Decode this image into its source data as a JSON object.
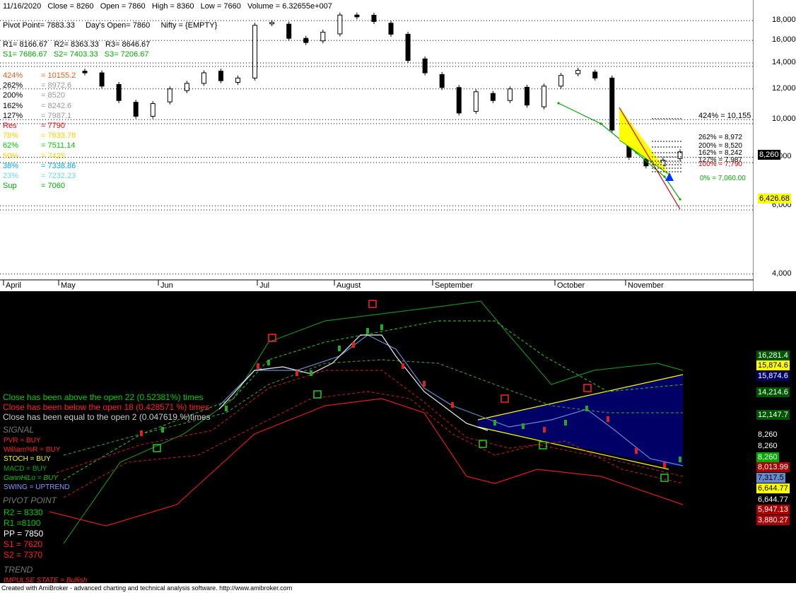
{
  "header": {
    "date": "11/16/2020",
    "close": "Close = 8260",
    "open": "Open = 7860",
    "high": "High = 8360",
    "low": "Low = 7660",
    "volume": "Volume = 6.32655e+007",
    "pivot": "Pivot Point= 7883.33",
    "days_open": "Day's Open= 7860",
    "nifty": "Nifty = {EMPTY}",
    "r1": "R1= 8166.67",
    "r2": "R2= 8363.33",
    "r3": "R3= 8646.67",
    "s1": "S1= 7686.67",
    "s2": "S2= 7403.33",
    "s3": "S3= 7206.67"
  },
  "fib_levels": [
    {
      "label": "424%",
      "value": "10155.2",
      "color": "#e06020"
    },
    {
      "label": "262%",
      "value": "8972.6",
      "color": "#999999"
    },
    {
      "label": "200%",
      "value": "8520",
      "color": "#999999"
    },
    {
      "label": "162%",
      "value": "8242.6",
      "color": "#999999"
    },
    {
      "label": "127%",
      "value": "7987.1",
      "color": "#999999"
    },
    {
      "label": "Res",
      "value": "7790",
      "color": "#ff0000"
    },
    {
      "label": "78%",
      "value": "7633.78",
      "color": "#ffcc00"
    },
    {
      "label": "62%",
      "value": "7511.14",
      "color": "#00cc00"
    },
    {
      "label": "50%",
      "value": "7425",
      "color": "#ffcc00"
    },
    {
      "label": "38%",
      "value": "7338.86",
      "color": "#00aaff"
    },
    {
      "label": "23%",
      "value": "7232.23",
      "color": "#66dddd"
    },
    {
      "label": "Sup",
      "value": "7060",
      "color": "#00aa00"
    }
  ],
  "fib_right_labels": [
    {
      "text": "424% = 10,155"
    },
    {
      "text": "262% = 8,972"
    },
    {
      "text": "200% = 8,520"
    },
    {
      "text": "162% = 8,242"
    },
    {
      "text": "127% = 7,987"
    },
    {
      "text": "100% = 7,790"
    },
    {
      "text": "0% = 7,060.00"
    }
  ],
  "price_tags_top": [
    {
      "text": "8,260",
      "bg": "#000000",
      "fg": "#ffffff"
    },
    {
      "text": "6,426.68",
      "bg": "#ffff00",
      "fg": "#000000"
    }
  ],
  "y_axis_top": [
    "18,000",
    "16,000",
    "14,000",
    "12,000",
    "10,000",
    "8,000",
    "6,000",
    "4,000"
  ],
  "x_axis": [
    "April",
    "May",
    "Jun",
    "Jul",
    "August",
    "September",
    "October",
    "November"
  ],
  "stats": [
    {
      "text": "Close has been above the open 22 (0.52381%) times",
      "color": "#00cc00"
    },
    {
      "text": "Close has been below the open 18 (0.428571 %) times",
      "color": "#ff2020"
    },
    {
      "text": "Close has been equal to the open 2 (0.047619 %)times",
      "color": "#cccccc"
    }
  ],
  "signal": {
    "title": "SIGNAL",
    "items": [
      {
        "text": "PVR = BUY",
        "color": "#ff2020"
      },
      {
        "text": "William%R = BUY",
        "color": "#ff2020"
      },
      {
        "text": "STOCH = BUY",
        "color": "#ffff00"
      },
      {
        "text": "MACD = BUY",
        "color": "#00aa00"
      },
      {
        "text": "GannHiLo = BUY",
        "color": "#00cc00"
      },
      {
        "text": "SWING = UPTREND",
        "color": "#8899ff"
      }
    ]
  },
  "pivot_point": {
    "title": "PIVOT POINT",
    "items": [
      {
        "text": "R2 = 8330",
        "color": "#00cc00"
      },
      {
        "text": "R1 =8100",
        "color": "#00cc00"
      },
      {
        "text": "PP = 7850",
        "color": "#ffffff"
      },
      {
        "text": "S1 = 7620",
        "color": "#ff2020"
      },
      {
        "text": "S2 = 7370",
        "color": "#ff2020"
      }
    ]
  },
  "trend": {
    "title": "TREND",
    "impulse": "IMPULSE STATE = Bullish",
    "impulse_color": "#ff2020"
  },
  "price_tags_bottom": [
    {
      "text": "16,281.4",
      "bg": "#005500",
      "fg": "#ffffff"
    },
    {
      "text": "15,874.6",
      "bg": "#ffff00",
      "fg": "#000000"
    },
    {
      "text": "15,874.6",
      "bg": "#000066",
      "fg": "#ffffff"
    },
    {
      "text": "14,214.6",
      "bg": "#005500",
      "fg": "#ffffff"
    },
    {
      "text": "12,147.7",
      "bg": "#005500",
      "fg": "#ffffff"
    },
    {
      "text": "8,260",
      "bg": "#000000",
      "fg": "#ffffff"
    },
    {
      "text": "8,260",
      "bg": "#000000",
      "fg": "#ffffff"
    },
    {
      "text": "8,260",
      "bg": "#00aa00",
      "fg": "#ffffff"
    },
    {
      "text": "8,013.99",
      "bg": "#aa0000",
      "fg": "#ffffff"
    },
    {
      "text": "7,317.5",
      "bg": "#6688cc",
      "fg": "#000000"
    },
    {
      "text": "6,644.77",
      "bg": "#ffff00",
      "fg": "#000000"
    },
    {
      "text": "6,644.77",
      "bg": "#000000",
      "fg": "#ffffff"
    },
    {
      "text": "5,947.13",
      "bg": "#aa0000",
      "fg": "#ffffff"
    },
    {
      "text": "3,880.27",
      "bg": "#aa0000",
      "fg": "#ffffff"
    }
  ],
  "footer": "Created with AmiBroker - advanced charting and technical analysis software. http://www.amibroker.com",
  "chart_data": {
    "type": "candlestick",
    "title": "",
    "y_scale": "log",
    "ylim": [
      3800,
      19500
    ],
    "x": [
      "Apr",
      "May",
      "Jun",
      "Jul",
      "Aug",
      "Sep",
      "Oct",
      "Nov"
    ],
    "close": [
      13200,
      12200,
      11200,
      10200,
      11000,
      12000,
      12400,
      13200,
      12600,
      12800,
      17500,
      17800,
      16200,
      15800,
      16800,
      18600,
      18400,
      17900,
      16600,
      14200,
      13200,
      12100,
      10400,
      11800,
      11200,
      12000,
      10900,
      12200,
      13000,
      13400,
      12800,
      9400,
      8000,
      7600,
      7860,
      8260
    ],
    "last_close": 8260,
    "pivot": 7883.33
  }
}
